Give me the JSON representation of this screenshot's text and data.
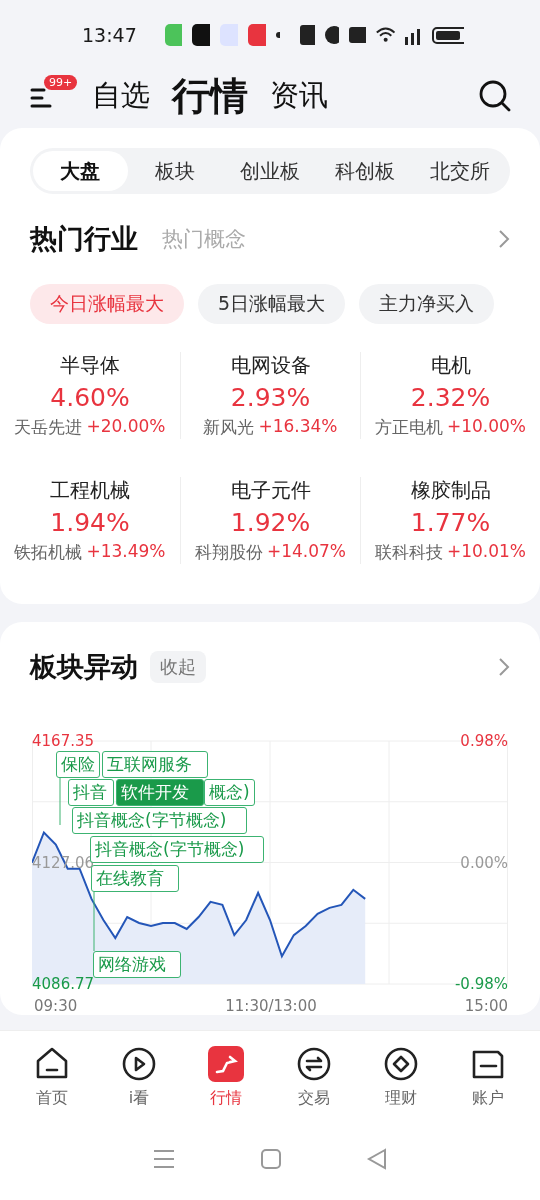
{
  "status_bar": {
    "time": "13:47"
  },
  "header": {
    "badge": "99+",
    "tabs": [
      {
        "label": "自选",
        "selected": false
      },
      {
        "label": "行情",
        "selected": true
      },
      {
        "label": "资讯",
        "selected": false
      }
    ]
  },
  "market_tabs": [
    {
      "label": "大盘",
      "selected": true
    },
    {
      "label": "板块",
      "selected": false
    },
    {
      "label": "创业板",
      "selected": false
    },
    {
      "label": "科创板",
      "selected": false
    },
    {
      "label": "北交所",
      "selected": false
    }
  ],
  "industry": {
    "tabs": [
      {
        "label": "热门行业",
        "selected": true
      },
      {
        "label": "热门概念",
        "selected": false
      }
    ],
    "filters": [
      {
        "label": "今日涨幅最大",
        "selected": true
      },
      {
        "label": "5日涨幅最大",
        "selected": false
      },
      {
        "label": "主力净买入",
        "selected": false
      }
    ],
    "items": [
      {
        "name": "半导体",
        "change": "4.60%",
        "leader": "天岳先进",
        "leader_change": "+20.00%"
      },
      {
        "name": "电网设备",
        "change": "2.93%",
        "leader": "新风光",
        "leader_change": "+16.34%"
      },
      {
        "name": "电机",
        "change": "2.32%",
        "leader": "方正电机",
        "leader_change": "+10.00%"
      },
      {
        "name": "工程机械",
        "change": "1.94%",
        "leader": "铁拓机械",
        "leader_change": "+13.49%"
      },
      {
        "name": "电子元件",
        "change": "1.92%",
        "leader": "科翔股份",
        "leader_change": "+14.07%"
      },
      {
        "name": "橡胶制品",
        "change": "1.77%",
        "leader": "联科科技",
        "leader_change": "+10.01%"
      }
    ]
  },
  "movers": {
    "title": "板块异动",
    "toggle": "收起",
    "right_axis_labels": [
      "0.98%",
      "0.00%",
      "-0.98%"
    ],
    "x_axis_labels": [
      "09:30",
      "11:30/13:00",
      "15:00"
    ],
    "chart_data": {
      "type": "line",
      "grid": true,
      "ylim": [
        4086.77,
        4167.35
      ],
      "yticks": [
        {
          "value": 4167.35,
          "label": "4167.35"
        },
        {
          "value": 4127.06,
          "label": "4127.06"
        },
        {
          "value": 4086.77,
          "label": "4086.77"
        }
      ],
      "series": [
        {
          "color": "#2456b8",
          "values": [
            4127,
            4137,
            4133,
            4125,
            4125,
            4115,
            4108,
            4102,
            4109,
            4107,
            4106,
            4107,
            4107,
            4105,
            4109,
            4114,
            4113,
            4103,
            4108,
            4117,
            4108,
            4096,
            4103,
            4106,
            4110,
            4112,
            4113,
            4118,
            4115,
            null,
            null,
            null,
            null,
            null,
            null,
            null,
            null,
            null,
            null,
            null,
            null
          ]
        }
      ]
    },
    "tags": [
      {
        "text": "保险",
        "kind": "outline"
      },
      {
        "text": "互联网服务",
        "kind": "outline"
      },
      {
        "text": "抖音",
        "kind": "outline"
      },
      {
        "text": "软件开发",
        "kind": "filled"
      },
      {
        "text": "概念)",
        "kind": "outline"
      },
      {
        "text": "抖音概念(字节概念)",
        "kind": "outline"
      },
      {
        "text": "抖音概念(字节概念)",
        "kind": "outline"
      },
      {
        "text": "在线教育",
        "kind": "outline"
      },
      {
        "text": "网络游戏",
        "kind": "outline"
      }
    ]
  },
  "bottom_nav": [
    {
      "label": "首页",
      "selected": false
    },
    {
      "label": "i看",
      "selected": false
    },
    {
      "label": "行情",
      "selected": true
    },
    {
      "label": "交易",
      "selected": false
    },
    {
      "label": "理财",
      "selected": false
    },
    {
      "label": "账户",
      "selected": false
    }
  ]
}
